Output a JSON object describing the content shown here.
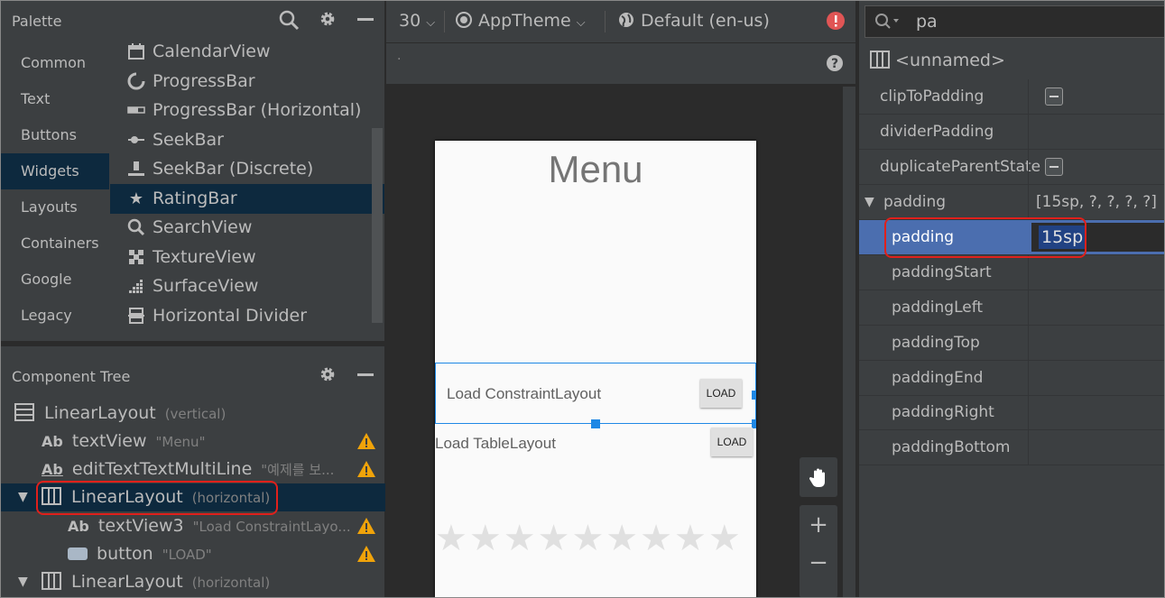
{
  "palette": {
    "title": "Palette",
    "categories": [
      "Common",
      "Text",
      "Buttons",
      "Widgets",
      "Layouts",
      "Containers",
      "Google",
      "Legacy"
    ],
    "items": [
      {
        "label": "CalendarView",
        "icon": "calendar-icon"
      },
      {
        "label": "ProgressBar",
        "icon": "progress-circle-icon"
      },
      {
        "label": "ProgressBar (Horizontal)",
        "icon": "progress-bar-icon"
      },
      {
        "label": "SeekBar",
        "icon": "seekbar-icon"
      },
      {
        "label": "SeekBar (Discrete)",
        "icon": "seekbar-discrete-icon"
      },
      {
        "label": "RatingBar",
        "icon": "star-icon"
      },
      {
        "label": "SearchView",
        "icon": "search-icon"
      },
      {
        "label": "TextureView",
        "icon": "texture-icon"
      },
      {
        "label": "SurfaceView",
        "icon": "surface-icon"
      },
      {
        "label": "Horizontal Divider",
        "icon": "divider-icon"
      }
    ]
  },
  "component_tree": {
    "title": "Component Tree",
    "rows": [
      {
        "label": "LinearLayout",
        "hint": "(vertical)"
      },
      {
        "label": "textView",
        "hint": "\"Menu\""
      },
      {
        "label": "editTextTextMultiLine",
        "hint": "\"예제를 보..."
      },
      {
        "label": "LinearLayout",
        "hint": "(horizontal)"
      },
      {
        "label": "textView3",
        "hint": "\"Load ConstraintLayo..."
      },
      {
        "label": "button",
        "hint": "\"LOAD\""
      },
      {
        "label": "LinearLayout",
        "hint": "(horizontal)"
      }
    ]
  },
  "toolbar": {
    "api": "30",
    "theme": "AppTheme",
    "locale": "Default (en-us)"
  },
  "preview": {
    "title": "Menu",
    "row1_label": "Load ConstraintLayout",
    "row1_button": "LOAD",
    "row2_label": "Load TableLayout",
    "row2_button": "LOAD",
    "stars": "★★★★★★★★★"
  },
  "attributes": {
    "search": "pa",
    "component": "<unnamed>",
    "rows": [
      {
        "name": "clipToPadding",
        "value": ""
      },
      {
        "name": "dividerPadding",
        "value": ""
      },
      {
        "name": "duplicateParentState",
        "value": ""
      },
      {
        "name": "padding",
        "value": "[15sp, ?, ?, ?, ?]"
      },
      {
        "name": "padding",
        "value": "15sp"
      },
      {
        "name": "paddingStart",
        "value": ""
      },
      {
        "name": "paddingLeft",
        "value": ""
      },
      {
        "name": "paddingTop",
        "value": ""
      },
      {
        "name": "paddingEnd",
        "value": ""
      },
      {
        "name": "paddingRight",
        "value": ""
      },
      {
        "name": "paddingBottom",
        "value": ""
      }
    ]
  },
  "colors": {
    "selection": "#0d293e",
    "attr_selected": "#4b6eaf",
    "highlight_box": "#e0201b",
    "warning": "#f0a30a",
    "error": "#e05555"
  }
}
